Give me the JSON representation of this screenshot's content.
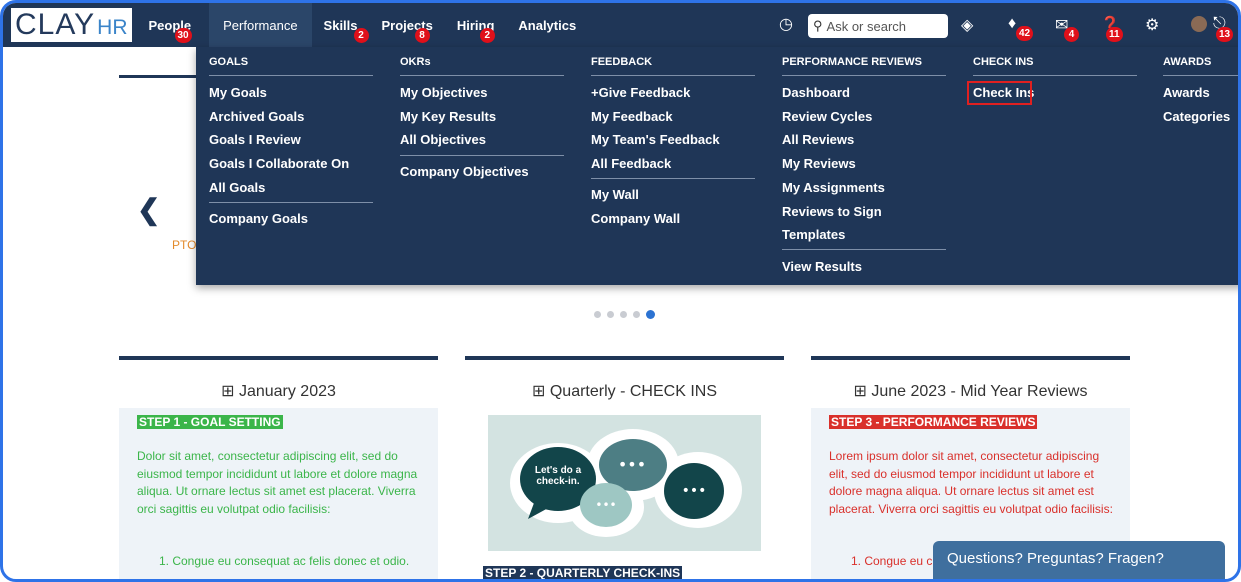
{
  "logo": {
    "main": "CLAY",
    "suffix": "HR"
  },
  "nav": {
    "items": [
      {
        "label": "People",
        "badge": "30"
      },
      {
        "label": "Performance",
        "badge": ""
      },
      {
        "label": "Skills",
        "badge": "2"
      },
      {
        "label": "Projects",
        "badge": "8"
      },
      {
        "label": "Hiring",
        "badge": "2"
      },
      {
        "label": "Analytics",
        "badge": ""
      }
    ],
    "search_placeholder": "Ask or search",
    "notifications_badge": "42",
    "messages_badge": "4",
    "help_badge": "11",
    "lock_badge": "13"
  },
  "mega_menu": {
    "goals": {
      "heading": "GOALS",
      "items": [
        "My Goals",
        "Archived Goals",
        "Goals I Review",
        "Goals I Collaborate On",
        "All Goals",
        "Company Goals"
      ]
    },
    "okrs": {
      "heading": "OKRs",
      "items": [
        "My Objectives",
        "My Key Results",
        "All Objectives",
        "Company Objectives"
      ]
    },
    "feedback": {
      "heading": "FEEDBACK",
      "items": [
        "+Give Feedback",
        "My Feedback",
        "My Team's Feedback",
        "All Feedback",
        "My Wall",
        "Company Wall"
      ]
    },
    "reviews": {
      "heading": "PERFORMANCE REVIEWS",
      "items": [
        "Dashboard",
        "Review Cycles",
        "All Reviews",
        "My Reviews",
        "My Assignments",
        "Reviews to Sign",
        "Templates",
        "View Results"
      ]
    },
    "checkins": {
      "heading": "CHECK INS",
      "items": [
        "Check Ins"
      ]
    },
    "awards": {
      "heading": "AWARDS",
      "items": [
        "Awards",
        "Categories"
      ]
    }
  },
  "page": {
    "pto_fragment": "PTO",
    "cards": [
      {
        "title": "January 2023",
        "step": "STEP 1 - GOAL SETTING",
        "text": "Dolor sit amet, consectetur adipiscing elit, sed do eiusmod tempor incididunt ut labore et dolore magna aliqua. Ut ornare lectus sit amet est placerat. Viverra orci sagittis eu volutpat odio facilisis:",
        "list_item": "1. Congue eu consequat ac felis donec et odio."
      },
      {
        "title": "Quarterly - CHECK INS",
        "bubble_text": "Let's do a check-in.",
        "step": "STEP 2 - QUARTERLY CHECK-INS"
      },
      {
        "title": "June 2023 - Mid Year Reviews",
        "step": "STEP 3 - PERFORMANCE REVIEWS",
        "text": "Lorem ipsum dolor sit amet, consectetur adipiscing elit, sed do eiusmod tempor incididunt ut labore et dolore magna aliqua. Ut ornare lectus sit amet est placerat. Viverra orci sagittis eu volutpat odio facilisis:",
        "list_item": "1. Congue eu c"
      }
    ],
    "chat_label": "Questions? Preguntas? Fragen?"
  },
  "colors": {
    "navy": "#1f3657",
    "highlight": "#e02020",
    "green": "#3bb54a",
    "red": "#d9302b",
    "accent": "#2e73e8"
  }
}
